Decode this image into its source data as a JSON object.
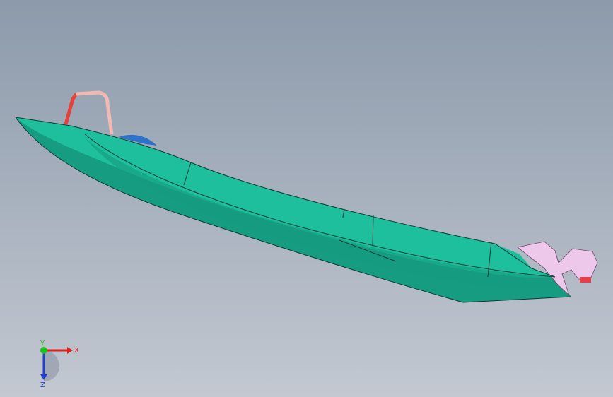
{
  "viewport": {
    "background_top": "#8c9aab",
    "background_bottom": "#c3c8d1"
  },
  "model": {
    "hull_color": "#1dbf9c",
    "hull_shadow_color": "#169c80",
    "hull_edge_color": "#0d3b32",
    "rail_color_left": "#e8403a",
    "rail_color_right": "#f2b8b3",
    "canopy_color": "#2d72c9",
    "motor_color": "#eec8ea"
  },
  "triad": {
    "x_label": "X",
    "y_label": "Y",
    "z_label": "Z",
    "x_color": "#e02020",
    "y_color": "#20c020",
    "z_color": "#2040d0"
  }
}
